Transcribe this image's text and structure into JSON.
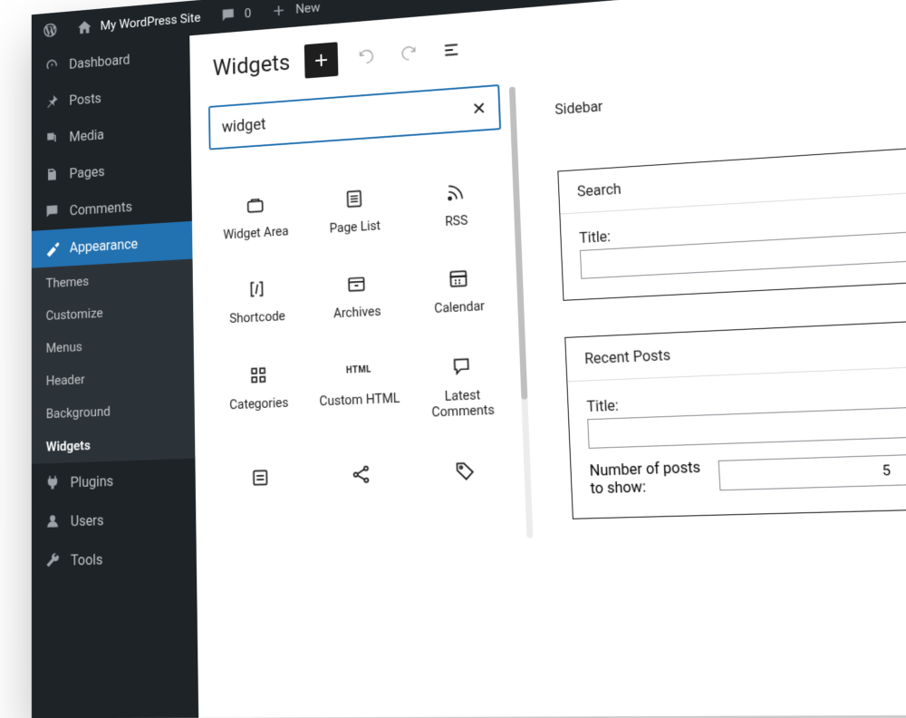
{
  "adminbar": {
    "site_name": "My WordPress Site",
    "comment_count": "0",
    "new_label": "New"
  },
  "nav": {
    "dashboard": "Dashboard",
    "posts": "Posts",
    "media": "Media",
    "pages": "Pages",
    "comments": "Comments",
    "appearance": "Appearance",
    "plugins": "Plugins",
    "users": "Users",
    "tools": "Tools",
    "appearance_sub": {
      "themes": "Themes",
      "customize": "Customize",
      "menus": "Menus",
      "header": "Header",
      "background": "Background",
      "widgets": "Widgets"
    }
  },
  "editor": {
    "title": "Widgets",
    "search_value": "widget",
    "blocks": {
      "widget_area": "Widget Area",
      "page_list": "Page List",
      "rss": "RSS",
      "shortcode": "Shortcode",
      "archives": "Archives",
      "calendar": "Calendar",
      "categories": "Categories",
      "custom_html": "Custom HTML",
      "custom_html_icon": "HTML",
      "latest_comments": "Latest Comments"
    },
    "area_name": "Sidebar"
  },
  "widgets": {
    "search": {
      "title": "Search",
      "field_title": "Title:"
    },
    "recent_posts": {
      "title": "Recent Posts",
      "field_title": "Title:",
      "num_label": "Number of posts to show:",
      "num_value": "5"
    }
  }
}
